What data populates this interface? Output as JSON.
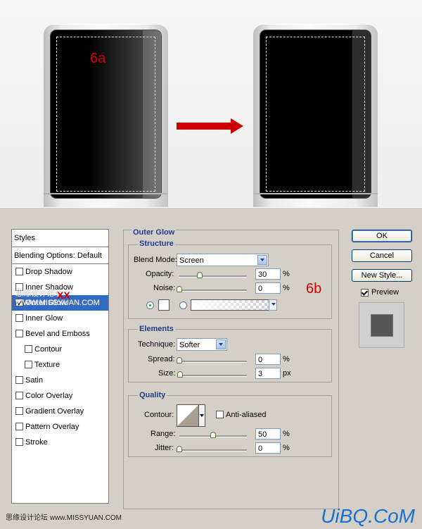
{
  "illustration": {
    "label_left": "6a",
    "label_dialog": "6b"
  },
  "dialog": {
    "styles_panel": {
      "title": "Styles",
      "blending_default": "Blending Options: Default",
      "watermark_site": "思缘设计论坛 WWW.MISSYUAN.COM",
      "watermark_mark": "XX",
      "items": [
        {
          "label": "Drop Shadow",
          "checked": false
        },
        {
          "label": "Inner Shadow",
          "checked": false
        },
        {
          "label": "Outer Glow",
          "checked": true,
          "selected": true
        },
        {
          "label": "Inner Glow",
          "checked": false
        },
        {
          "label": "Bevel and Emboss",
          "checked": false
        },
        {
          "label": "Contour",
          "checked": false,
          "sub": true
        },
        {
          "label": "Texture",
          "checked": false,
          "sub": true
        },
        {
          "label": "Satin",
          "checked": false
        },
        {
          "label": "Color Overlay",
          "checked": false
        },
        {
          "label": "Gradient Overlay",
          "checked": false
        },
        {
          "label": "Pattern Overlay",
          "checked": false
        },
        {
          "label": "Stroke",
          "checked": false
        }
      ]
    },
    "outer_glow": {
      "title": "Outer Glow",
      "structure": {
        "title": "Structure",
        "blend_mode_label": "Blend Mode:",
        "blend_mode_value": "Screen",
        "opacity_label": "Opacity:",
        "opacity_value": "30",
        "opacity_level": 30,
        "opacity_unit": "%",
        "noise_label": "Noise:",
        "noise_value": "0",
        "noise_level": 0,
        "noise_unit": "%",
        "color_mode": "solid"
      },
      "elements": {
        "title": "Elements",
        "technique_label": "Technique:",
        "technique_value": "Softer",
        "spread_label": "Spread:",
        "spread_value": "0",
        "spread_level": 0,
        "spread_unit": "%",
        "size_label": "Size:",
        "size_value": "3",
        "size_level": 1.2,
        "size_unit": "px"
      },
      "quality": {
        "title": "Quality",
        "contour_label": "Contour:",
        "anti_aliased_label": "Anti-aliased",
        "anti_aliased": false,
        "range_label": "Range:",
        "range_value": "50",
        "range_level": 50,
        "range_unit": "%",
        "jitter_label": "Jitter:",
        "jitter_value": "0",
        "jitter_level": 0,
        "jitter_unit": "%"
      }
    },
    "buttons": {
      "ok": "OK",
      "cancel": "Cancel",
      "new_style": "New Style...",
      "preview_label": "Preview",
      "preview_checked": true
    }
  },
  "footer": {
    "left_text": "思缘设计论坛 www.MISSYUAN.COM",
    "right_text": "UiBQ.CoM"
  },
  "colors": {
    "accent_red": "#cc0000",
    "selection_blue": "#316ac5",
    "group_title_blue": "#1f3c8c",
    "dialog_bg": "#d4d0c8"
  }
}
